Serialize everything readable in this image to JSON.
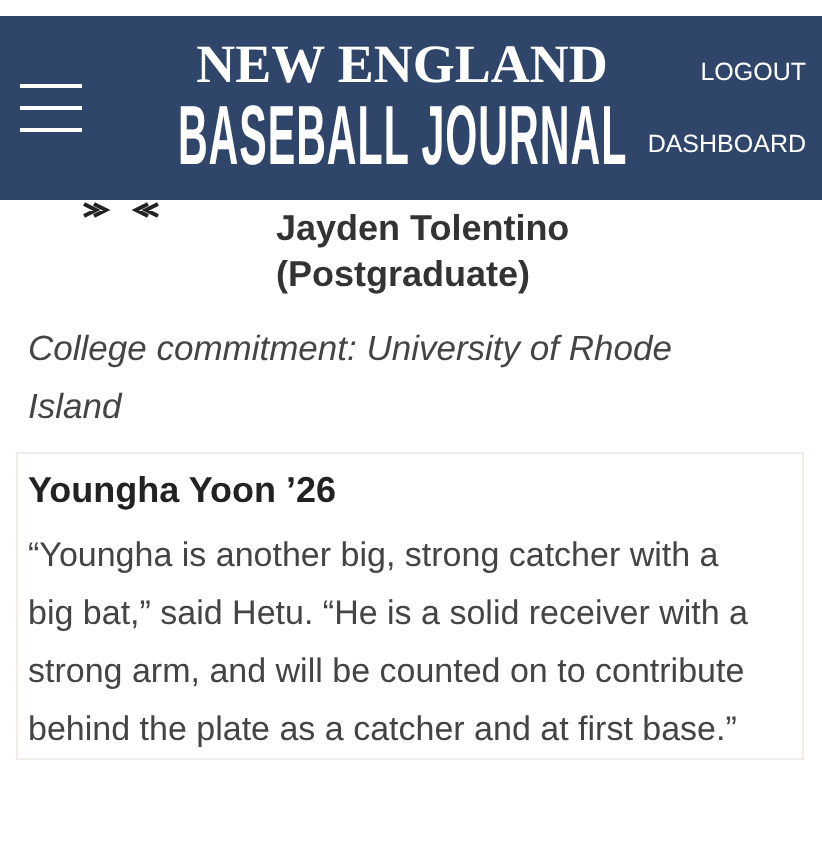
{
  "header": {
    "logo_top": "NEW ENGLAND",
    "logo_bottom": "BASEBALL JOURNAL",
    "links": [
      "LOGOUT",
      "DASHBOARD"
    ]
  },
  "caption": "Jayden Tolentino (Postgraduate)",
  "commitment": "College commitment: University of Rhode Island",
  "player": {
    "name": "Youngha Yoon ’26",
    "quote": "“Youngha is another big, strong catcher with a big bat,” said Hetu. “He is a solid receiver with a strong arm, and will be counted on to contribute behind the plate as a catcher and at first base.”"
  }
}
